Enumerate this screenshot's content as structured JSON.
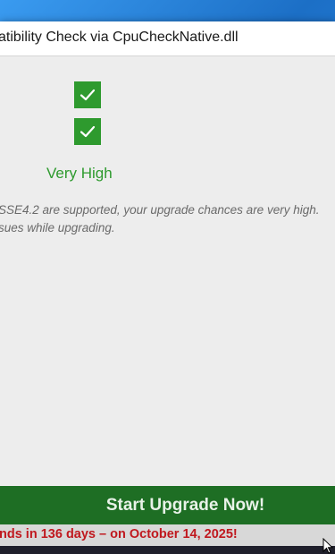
{
  "window": {
    "title": "atibility Check via CpuCheckNative.dll"
  },
  "result": {
    "checks": [
      {
        "icon": "check-icon",
        "status": "pass"
      },
      {
        "icon": "check-icon",
        "status": "pass"
      }
    ],
    "rating": "Very High",
    "description_line1": "SSE4.2 are supported, your upgrade chances are very high.",
    "description_line2": "sues while upgrading."
  },
  "actions": {
    "upgrade_label": "Start Upgrade Now!"
  },
  "banner": {
    "end_of_life_text": "nds in 136 days – on October 14, 2025!"
  },
  "colors": {
    "success": "#2e9a2e",
    "button": "#1e6e24",
    "warning_text": "#c0181e"
  }
}
